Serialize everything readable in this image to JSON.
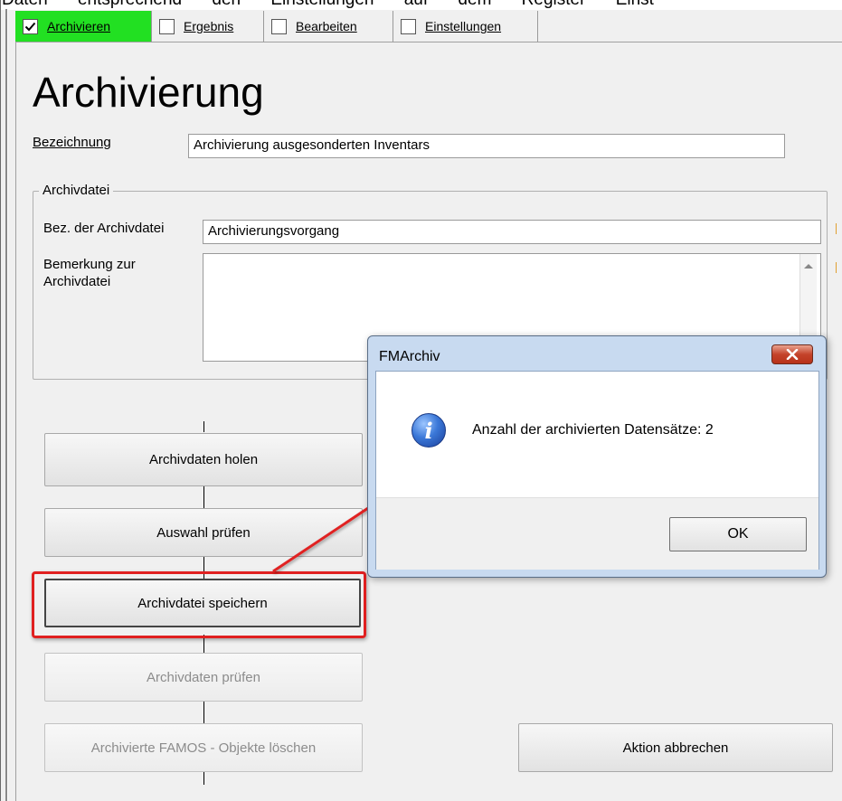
{
  "document_text_fragment": "Daten entsprechend den Einstellungen auf dem Register Einst",
  "tabs": [
    {
      "label": "Archivieren",
      "checked": true,
      "active": true
    },
    {
      "label": "Ergebnis",
      "checked": false,
      "active": false
    },
    {
      "label": "Bearbeiten",
      "checked": false,
      "active": false
    },
    {
      "label": "Einstellungen",
      "checked": false,
      "active": false
    }
  ],
  "page_title": "Archivierung",
  "fields": {
    "bezeichnung_label": "Bezeichnung",
    "bezeichnung_value": "Archivierung ausgesonderten Inventars"
  },
  "archivdatei": {
    "group_title": "Archivdatei",
    "bez_label": "Bez. der Archivdatei",
    "bez_value": "Archivierungsvorgang",
    "bemerkung_label_line1": "Bemerkung zur",
    "bemerkung_label_line2": "Archivdatei",
    "bemerkung_value": ""
  },
  "workflow": {
    "holen": "Archivdaten holen",
    "pruefen_auswahl": "Auswahl prüfen",
    "speichern": "Archivdatei speichern",
    "pruefen_daten": "Archivdaten prüfen",
    "loeschen": "Archivierte FAMOS - Objekte löschen",
    "abbrechen": "Aktion abbrechen"
  },
  "dialog": {
    "title": "FMArchiv",
    "message": "Anzahl der archivierten Datensätze: 2",
    "ok_label": "OK"
  },
  "colors": {
    "active_tab": "#22e022",
    "highlight": "#e02020",
    "dialog_frame": "#c8daf0",
    "close_button": "#c4432a"
  }
}
